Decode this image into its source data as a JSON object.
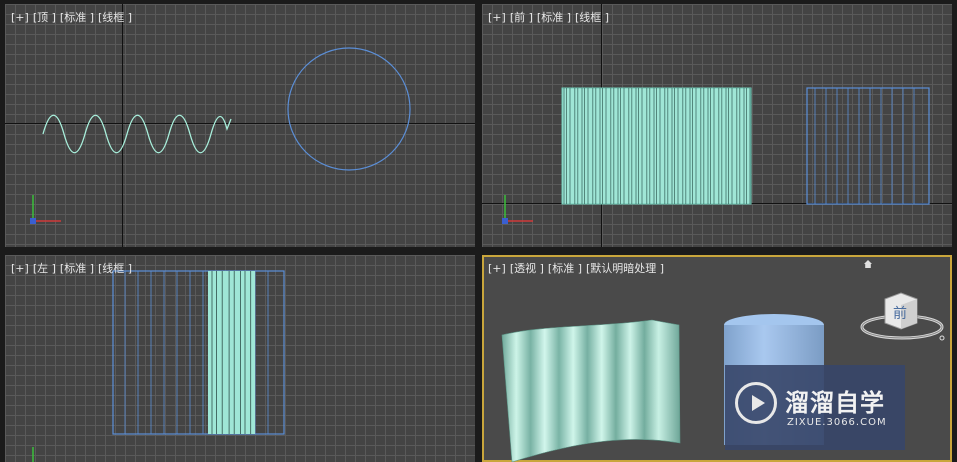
{
  "viewports": {
    "top": {
      "labels": [
        "[+]",
        "[顶 ]",
        "[标准 ]",
        "[线框 ]"
      ]
    },
    "front": {
      "labels": [
        "[+]",
        "[前 ]",
        "[标准 ]",
        "[线框 ]"
      ]
    },
    "left": {
      "labels": [
        "[+]",
        "[左 ]",
        "[标准 ]",
        "[线框 ]"
      ]
    },
    "perspective": {
      "labels": [
        "[+]",
        "[透视 ]",
        "[标准 ]",
        "[默认明暗处理 ]"
      ]
    }
  },
  "viewcube": {
    "face_label": "前"
  },
  "watermark": {
    "title": "溜溜自学",
    "url": "ZIXUE.3066.COM"
  },
  "colors": {
    "viewport_bg": "#444444",
    "grid": "#5a5a5a",
    "wave": "#a8f0dc",
    "blue_wire": "#5b8fd8",
    "curtain_fill": "#9fe6d6",
    "active_border": "#c9a63c"
  }
}
